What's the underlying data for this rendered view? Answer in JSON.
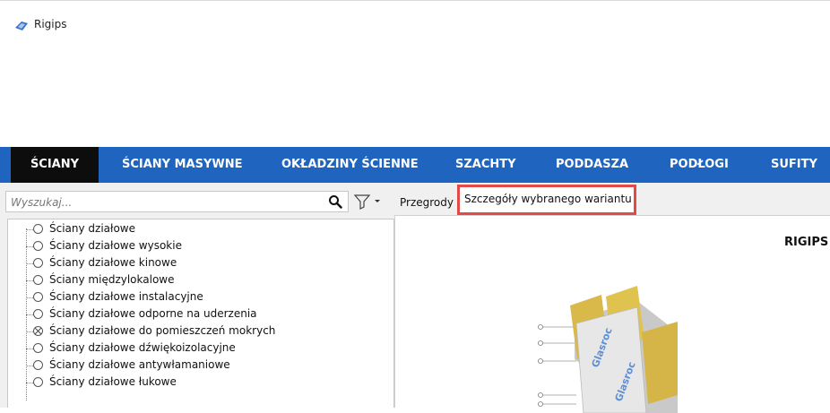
{
  "app": {
    "title": "Rigips"
  },
  "nav": {
    "items": [
      {
        "label": "ŚCIANY"
      },
      {
        "label": "ŚCIANY MASYWNE"
      },
      {
        "label": "OKŁADZINY ŚCIENNE"
      },
      {
        "label": "SZACHTY"
      },
      {
        "label": "PODDASZA"
      },
      {
        "label": "PODŁOGI"
      },
      {
        "label": "SUFITY"
      }
    ],
    "active_index": 0,
    "active_color": "#0d0d0d",
    "bar_color": "#1f64bf"
  },
  "search": {
    "placeholder": "Wyszukaj...",
    "value": ""
  },
  "tree": {
    "items": [
      {
        "label": "Ściany działowe",
        "checked": false
      },
      {
        "label": "Ściany działowe wysokie",
        "checked": false
      },
      {
        "label": "Ściany działowe kinowe",
        "checked": false
      },
      {
        "label": "Ściany międzylokalowe",
        "checked": false
      },
      {
        "label": "Ściany działowe instalacyjne",
        "checked": false
      },
      {
        "label": "Ściany działowe odporne na uderzenia",
        "checked": false
      },
      {
        "label": "Ściany działowe do pomieszczeń mokrych",
        "checked": true
      },
      {
        "label": "Ściany działowe dźwiękoizolacyjne",
        "checked": false
      },
      {
        "label": "Ściany działowe antywłamaniowe",
        "checked": false
      },
      {
        "label": "Ściany działowe łukowe",
        "checked": false
      }
    ]
  },
  "tabs": {
    "inactive_label": "Przegrody",
    "active_label": "Szczegóły wybranego wariantu",
    "highlight_color": "#e24a4a"
  },
  "detail": {
    "heading": "RIGIPS"
  }
}
